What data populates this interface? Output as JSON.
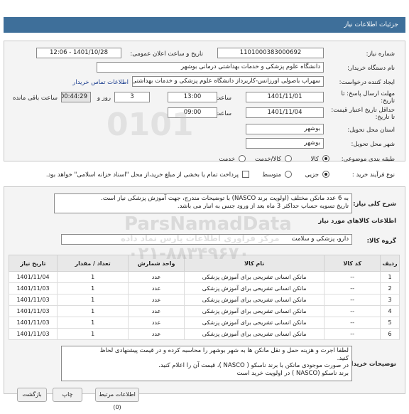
{
  "header": {
    "title": "جزئیات اطلاعات نیاز"
  },
  "form": {
    "need_number_label": "شماره نیاز:",
    "need_number": "1101000383000692",
    "announce_label": "تاریخ و ساعت اعلان عمومی:",
    "announce_value": "1401/10/28 - 12:06",
    "buyer_org_label": "نام دستگاه خریدار:",
    "buyer_org": "دانشگاه علوم پزشکی و خدمات بهداشتی درمانی بوشهر",
    "creator_label": "ایجاد کننده درخواست:",
    "creator": "سهراب باصولی اورزانس-کاربرداز دانشگاه علوم پزشکی و خدمات بهداشتی درمانی بوشهر",
    "contact_link": "اطلاعات تماس خریدار",
    "deadline_label": "مهلت ارسال پاسخ: تا تاریخ:",
    "deadline_date": "1401/11/01",
    "time_label": "ساعت",
    "deadline_time": "13:00",
    "days_value": "3",
    "days_label": "روز و",
    "remaining_time": "00:44:29",
    "remaining_label": "ساعت باقی مانده",
    "validity_label": "حداقل تاریخ اعتبار قیمت: تا تاریخ:",
    "validity_date": "1401/11/04",
    "validity_time": "09:00",
    "province_label": "استان محل تحویل:",
    "province": "بوشهر",
    "city_label": "شهر محل تحویل:",
    "city": "بوشهر",
    "category_label": "طبقه بندی موضوعی:",
    "category_options": [
      "کالا",
      "کالا/خدمت",
      "خدمت"
    ],
    "process_label": "نوع فرآیند خرید :",
    "process_options": [
      "جزیی",
      "متوسط"
    ],
    "payment_note": "پرداخت تمام یا بخشی از مبلغ خرید،از محل \"اسناد خزانه اسلامی\" خواهد بود."
  },
  "description": {
    "label": "شرح کلی نیاز:",
    "line1": "به 6 عدد مانکن مختلف (اولویت برند NASCO) با توضیحات مندرج، جهت آموزش پزشکی نیاز است.",
    "line2": "تاریخ تسویه حساب حداکثر 3 ماه بعد از ورود جنس به انبار می باشد."
  },
  "goods": {
    "section_title": "اطلاعات کالاهای مورد نیاز",
    "group_label": "گروه کالا:",
    "group_value": "دارو، پزشکی و سلامت",
    "columns": [
      "ردیف",
      "کد کالا",
      "نام کالا",
      "واحد شمارش",
      "تعداد / مقدار",
      "تاریخ نیاز"
    ],
    "rows": [
      {
        "no": "1",
        "code": "--",
        "name": "مانکن انسانی تشریحی برای آموزش پزشکی",
        "unit": "عدد",
        "qty": "1",
        "date": "1401/11/04"
      },
      {
        "no": "2",
        "code": "--",
        "name": "مانکن انسانی تشریحی برای آموزش پزشکی",
        "unit": "عدد",
        "qty": "1",
        "date": "1401/11/03"
      },
      {
        "no": "3",
        "code": "--",
        "name": "مانکن انسانی تشریحی برای آموزش پزشکی",
        "unit": "عدد",
        "qty": "1",
        "date": "1401/11/03"
      },
      {
        "no": "4",
        "code": "--",
        "name": "مانکن انسانی تشریحی برای آموزش پزشکی",
        "unit": "عدد",
        "qty": "1",
        "date": "1401/11/03"
      },
      {
        "no": "5",
        "code": "--",
        "name": "مانکن انسانی تشریحی برای آموزش پزشکی",
        "unit": "عدد",
        "qty": "1",
        "date": "1401/11/03"
      },
      {
        "no": "6",
        "code": "--",
        "name": "مانکن انسانی تشریحی برای آموزش پزشکی",
        "unit": "عدد",
        "qty": "1",
        "date": "1401/11/03"
      }
    ]
  },
  "buyer_notes": {
    "label": "توضیحات خریدار:",
    "line1": "لطفا اجرت و هزینه حمل و نقل مانکن ها به شهر بوشهر را محاسبه کرده و در قیمت پیشنهادی لحاظ",
    "line2": "کنید.",
    "line3": "در صورت موجودی مانکن با برند ناسکو ( NASCO )، قیمت آن را اعلام کنید.",
    "line4": "برند ناسکو (NASCO ) در اولویت خرید است"
  },
  "watermark": {
    "text1": "ParsNamadData",
    "text2": "۰۲۱-۸۸۳۴۹۶۷۰",
    "text3": "مرکز فراوری اطلاعات پارس نماد داده"
  },
  "buttons": {
    "b1": "بازگشت",
    "b2": "چاپ",
    "b3": "اطلاعات مرتبط (0)"
  },
  "colors": {
    "header_bg": "#3e6f9a",
    "link": "#1a3d8f"
  }
}
